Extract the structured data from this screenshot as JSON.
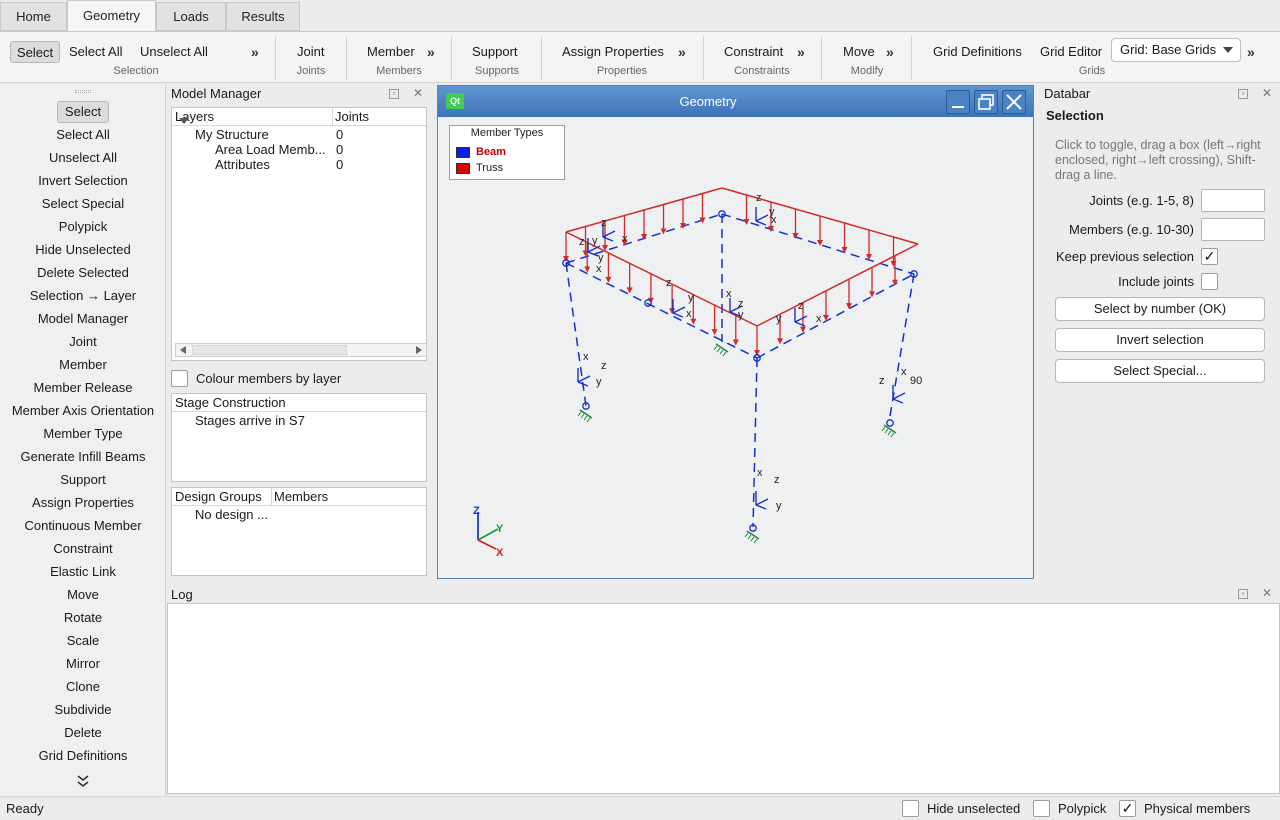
{
  "tabs": [
    "Home",
    "Geometry",
    "Loads",
    "Results"
  ],
  "active_tab": "Geometry",
  "ribbon": {
    "selection": {
      "select": "Select",
      "select_all": "Select All",
      "unselect_all": "Unselect All",
      "group": "Selection"
    },
    "joints": {
      "label": "Joint",
      "group": "Joints"
    },
    "members": {
      "label": "Member",
      "group": "Members"
    },
    "supports": {
      "label": "Support",
      "group": "Supports"
    },
    "properties": {
      "label": "Assign Properties",
      "group": "Properties"
    },
    "constraints": {
      "label": "Constraint",
      "group": "Constraints"
    },
    "modify": {
      "label": "Move",
      "group": "Modify"
    },
    "grids": {
      "grid_definitions": "Grid Definitions",
      "grid_editor": "Grid Editor",
      "combo_value": "Grid: Base Grids",
      "group": "Grids"
    },
    "more": "»"
  },
  "left_commands": [
    "Select",
    "Select All",
    "Unselect All",
    "Invert Selection",
    "Select Special",
    "Polypick",
    "Hide Unselected",
    "Delete Selected",
    "Selection → Layer",
    "Model Manager",
    "Joint",
    "Member",
    "Member Release",
    "Member Axis Orientation",
    "Member Type",
    "Generate Infill Beams",
    "Support",
    "Assign Properties",
    "Continuous Member",
    "Constraint",
    "Elastic Link",
    "Move",
    "Rotate",
    "Scale",
    "Mirror",
    "Clone",
    "Subdivide",
    "Delete",
    "Grid Definitions"
  ],
  "model_manager": {
    "title": "Model Manager",
    "columns": [
      "Layers",
      "Joints"
    ],
    "rows": [
      {
        "name": "My Structure",
        "joints": "0"
      },
      {
        "name": "Area Load Memb...",
        "joints": "0"
      },
      {
        "name": "Attributes",
        "joints": "0"
      }
    ],
    "colour_by_layer": "Colour members by layer",
    "stage_header": "Stage Construction",
    "stage_text": "Stages arrive in S7",
    "design_cols": [
      "Design Groups",
      "Members"
    ],
    "design_text": "No design ..."
  },
  "geometry": {
    "title": "Geometry",
    "qt": "Qt",
    "legend_title": "Member Types",
    "legend": [
      {
        "label": "Beam",
        "color": "#0a1ee6",
        "text_color": "#c00000"
      },
      {
        "label": "Truss",
        "color": "#e00000",
        "text_color": "#222222"
      }
    ],
    "axis_labels": {
      "x": "x",
      "y": "y",
      "z": "z",
      "X": "X",
      "Y": "Y",
      "Z": "Z",
      "ninety": "90"
    }
  },
  "databar": {
    "title": "Databar",
    "heading": "Selection",
    "hint": "Click to toggle, drag a box (left→right enclosed, right→left crossing), Shift-drag a line.",
    "joints_label": "Joints (e.g. 1-5, 8)",
    "members_label": "Members (e.g. 10-30)",
    "keep_label": "Keep previous selection",
    "include_label": "Include joints",
    "btn_select_number": "Select by number (OK)",
    "btn_invert": "Invert selection",
    "btn_special": "Select Special..."
  },
  "log": {
    "title": "Log"
  },
  "status": {
    "ready": "Ready",
    "hide_unselected": "Hide unselected",
    "polypick": "Polypick",
    "physical_members": "Physical members"
  },
  "colors": {
    "member_red": "#d12a2a",
    "beam_blue": "#1530d0",
    "accent": "#3e74b8"
  }
}
